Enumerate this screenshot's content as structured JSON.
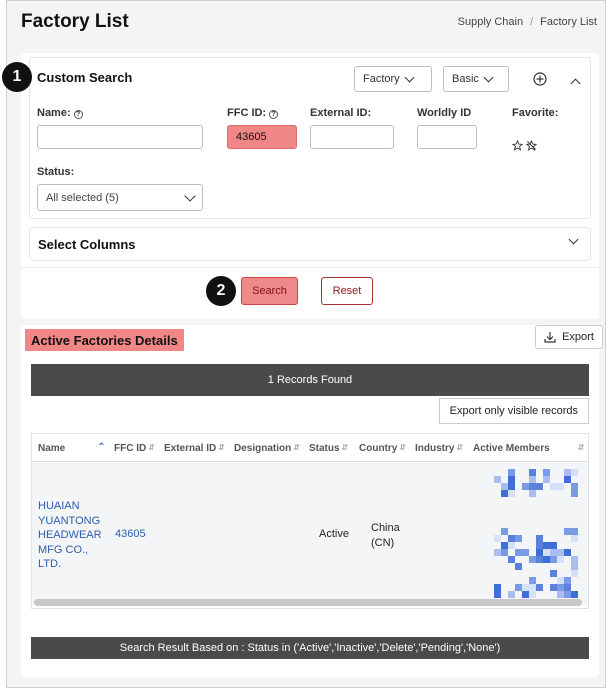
{
  "header": {
    "title": "Factory List",
    "breadcrumb": [
      "Supply Chain",
      "Factory List"
    ]
  },
  "custom_search": {
    "step": "1",
    "title": "Custom Search",
    "entity_dropdown": "Factory",
    "mode_dropdown": "Basic",
    "fields": {
      "name_label": "Name:",
      "name_value": "",
      "ffc_label": "FFC ID:",
      "ffc_value": "43605",
      "external_label": "External ID:",
      "external_value": "",
      "worldly_label": "Worldly ID",
      "worldly_value": "",
      "favorite_label": "Favorite:",
      "status_label": "Status:",
      "status_value": "All selected (5)"
    }
  },
  "select_columns": {
    "title": "Select Columns"
  },
  "actions": {
    "step": "2",
    "search_label": "Search",
    "reset_label": "Reset"
  },
  "results": {
    "title": "Active Factories Details",
    "export_label": "Export",
    "records_found": "1 Records Found",
    "export_visible_label": "Export only visible records",
    "columns": [
      "Name",
      "FFC ID",
      "External ID",
      "Designation",
      "Status",
      "Country",
      "Industry",
      "Active Members"
    ],
    "row": {
      "name_lines": [
        "HUAIAN",
        "YUANTONG",
        "HEADWEAR",
        "MFG CO.,",
        "LTD."
      ],
      "ffc_id": "43605",
      "status": "Active",
      "country_lines": [
        "China",
        "(CN)"
      ]
    },
    "footer": "Search Result Based on : Status in ('Active','Inactive','Delete','Pending','None')"
  },
  "colors": {
    "highlight": "#f08686",
    "link": "#2a5db0",
    "dark_bar": "#4a4a4a"
  }
}
